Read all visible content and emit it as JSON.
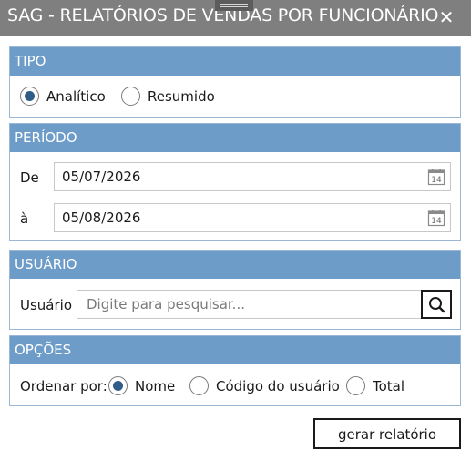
{
  "window": {
    "title": "SAG - RELATÓRIOS DE VENDAS POR FUNCIONÁRIO",
    "close_symbol": "✕"
  },
  "tipo": {
    "header": "TIPO",
    "options": [
      {
        "label": "Analítico",
        "selected": true
      },
      {
        "label": "Resumido",
        "selected": false
      }
    ]
  },
  "periodo": {
    "header": "PERÍODO",
    "from_label": "De",
    "from_value": "05/07/2026",
    "to_label": "à",
    "to_value": "05/08/2026",
    "calendar_day": "14"
  },
  "usuario": {
    "header": "USUÁRIO",
    "label": "Usuário",
    "placeholder": "Digite para pesquisar...",
    "value": ""
  },
  "opcoes": {
    "header": "OPÇÕES",
    "order_label": "Ordenar por:",
    "options": [
      {
        "label": "Nome",
        "selected": true
      },
      {
        "label": "Código do usuário",
        "selected": false
      },
      {
        "label": "Total",
        "selected": false
      }
    ]
  },
  "actions": {
    "generate_label": "gerar relatório"
  },
  "colors": {
    "title_bar": "#7f7f7f",
    "group_header": "#6e9cc8",
    "radio_selected": "#2f5d87"
  }
}
